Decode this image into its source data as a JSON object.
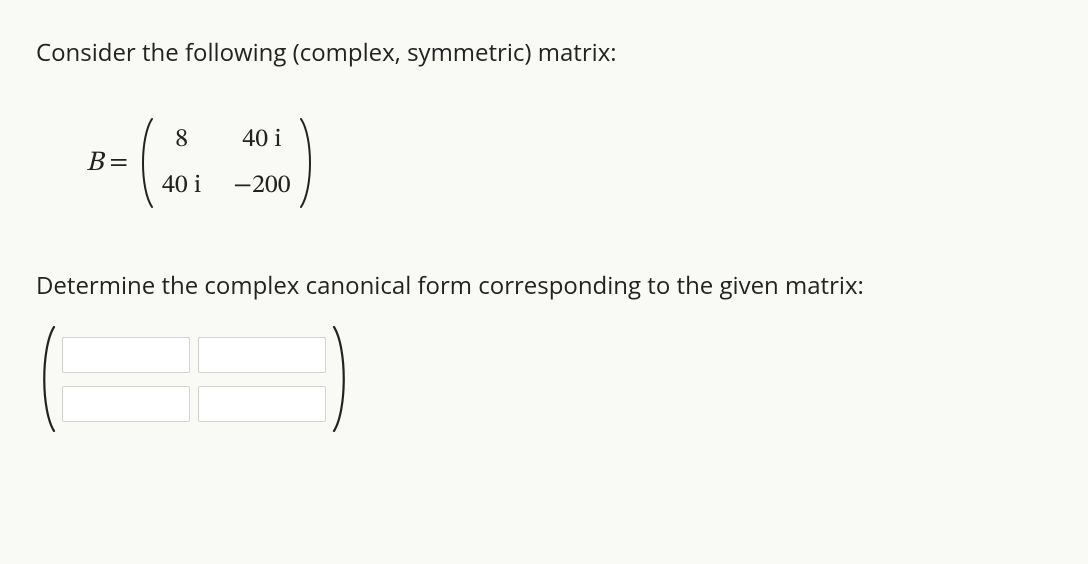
{
  "prompt_text": "Consider the following (complex, symmetric) matrix:",
  "matrix_label": "B",
  "equals": "=",
  "matrix_B": {
    "r1c1": "8",
    "r1c2": "40 i",
    "r2c1": "40 i",
    "r2c2": "−200"
  },
  "question_text": "Determine the complex canonical form corresponding to the given matrix:",
  "answer_values": {
    "r1c1": "",
    "r1c2": "",
    "r2c1": "",
    "r2c2": ""
  }
}
